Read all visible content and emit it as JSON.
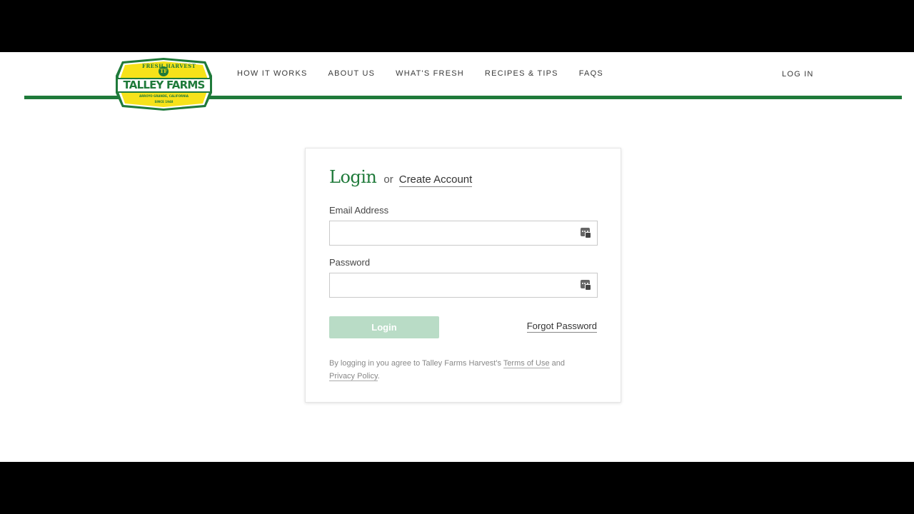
{
  "brand": {
    "logo_top_text": "FRESH HARVEST",
    "logo_monogram": "TF",
    "logo_name": "TALLEY FARMS",
    "logo_location": "ARROYO GRANDE, CALIFORNIA",
    "logo_since": "SINCE 1948"
  },
  "nav": {
    "items": [
      {
        "label": "HOW IT WORKS"
      },
      {
        "label": "ABOUT US"
      },
      {
        "label": "WHAT'S FRESH"
      },
      {
        "label": "RECIPES & TIPS"
      },
      {
        "label": "FAQS"
      }
    ],
    "login": "LOG IN"
  },
  "login_card": {
    "title": "Login",
    "or": "or",
    "create_account": "Create Account",
    "email_label": "Email Address",
    "email_value": "",
    "password_label": "Password",
    "password_value": "",
    "submit_label": "Login",
    "forgot_label": "Forgot Password",
    "terms_prefix": "By logging in you agree to Talley Farms Harvest's ",
    "terms_link": "Terms of Use",
    "terms_and": " and",
    "privacy_link": "Privacy Policy",
    "terms_end": "."
  },
  "colors": {
    "brand_green": "#1f7a3a",
    "logo_yellow": "#f6e21a",
    "button_disabled": "#b9dcc6"
  },
  "icons": {
    "field_autofill": "key-icon"
  }
}
